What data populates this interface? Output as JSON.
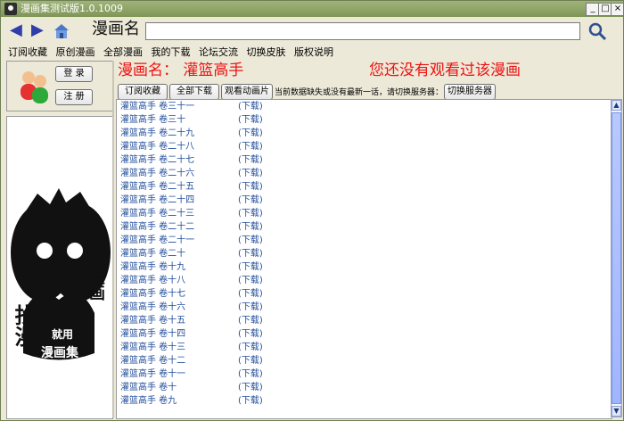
{
  "window": {
    "title": "漫画集测试版1.0.1009"
  },
  "window_controls": {
    "min": "_",
    "max": "□",
    "close": "×"
  },
  "toolbar": {
    "site_name": "漫画名"
  },
  "menu": {
    "items": [
      "订阅收藏",
      "原创漫画",
      "全部漫画",
      "我的下载",
      "论坛交流",
      "切换皮肤",
      "版权说明"
    ]
  },
  "auth": {
    "login": "登 录",
    "register": "注 册"
  },
  "logo": {
    "text_left": "找漫",
    "text_right": "漫画",
    "text_center_top": "就用",
    "text_center_bottom": "漫画集"
  },
  "comic": {
    "label": "漫画名：",
    "name": "灌篮高手",
    "status": "您还没有观看过该漫画"
  },
  "actions": {
    "subscribe": "订阅收藏",
    "download_all": "全部下载",
    "watch_anime": "观看动画片",
    "notice": "当前数据缺失或没有最新一话，请切换服务器：",
    "switch_server": "切换服务器"
  },
  "chapters": [
    {
      "title": "灌篮高手 卷三十一",
      "action": "(下载)"
    },
    {
      "title": "灌篮高手 卷三十",
      "action": "(下载)"
    },
    {
      "title": "灌篮高手 卷二十九",
      "action": "(下载)"
    },
    {
      "title": "灌篮高手 卷二十八",
      "action": "(下载)"
    },
    {
      "title": "灌篮高手 卷二十七",
      "action": "(下载)"
    },
    {
      "title": "灌篮高手 卷二十六",
      "action": "(下载)"
    },
    {
      "title": "灌篮高手 卷二十五",
      "action": "(下载)"
    },
    {
      "title": "灌篮高手 卷二十四",
      "action": "(下载)"
    },
    {
      "title": "灌篮高手 卷二十三",
      "action": "(下载)"
    },
    {
      "title": "灌篮高手 卷二十二",
      "action": "(下载)"
    },
    {
      "title": "灌篮高手 卷二十一",
      "action": "(下载)"
    },
    {
      "title": "灌篮高手 卷二十",
      "action": "(下载)"
    },
    {
      "title": "灌篮高手 卷十九",
      "action": "(下载)"
    },
    {
      "title": "灌篮高手 卷十八",
      "action": "(下载)"
    },
    {
      "title": "灌篮高手 卷十七",
      "action": "(下载)"
    },
    {
      "title": "灌篮高手 卷十六",
      "action": "(下载)"
    },
    {
      "title": "灌篮高手 卷十五",
      "action": "(下载)"
    },
    {
      "title": "灌篮高手 卷十四",
      "action": "(下载)"
    },
    {
      "title": "灌篮高手 卷十三",
      "action": "(下载)"
    },
    {
      "title": "灌篮高手 卷十二",
      "action": "(下载)"
    },
    {
      "title": "灌篮高手 卷十一",
      "action": "(下载)"
    },
    {
      "title": "灌篮高手 卷十",
      "action": "(下载)"
    },
    {
      "title": "灌篮高手 卷九",
      "action": "(下载)"
    }
  ],
  "colors": {
    "accent_red": "#e11111",
    "link_blue": "#1f4c9a",
    "titlebar": "#8fa566"
  }
}
